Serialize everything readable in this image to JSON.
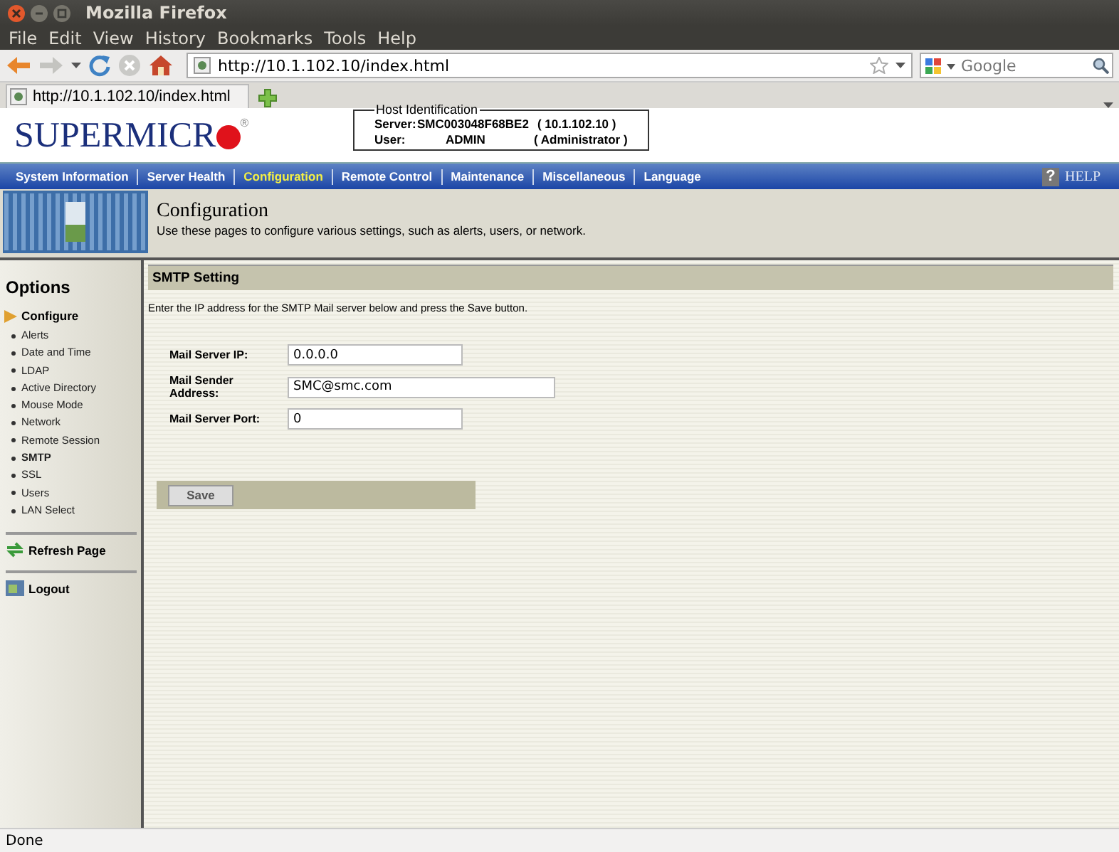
{
  "window": {
    "title": "Mozilla Firefox"
  },
  "menubar": [
    "File",
    "Edit",
    "View",
    "History",
    "Bookmarks",
    "Tools",
    "Help"
  ],
  "address_bar": {
    "value": "http://10.1.102.10/index.html"
  },
  "search": {
    "placeholder": "Google"
  },
  "tabs": [
    {
      "label": "http://10.1.102.10/index.html",
      "selected": true
    }
  ],
  "header": {
    "logo": "SUPERMICR",
    "logo_mark": "®",
    "host": {
      "legend": "Host Identification",
      "server_label": "Server:",
      "server_value": "SMC003048F68BE2",
      "server_ip": "(  10.1.102.10   )",
      "user_label": "User:",
      "user_value": "ADMIN",
      "user_role": "( Administrator )"
    }
  },
  "nav": {
    "items": [
      {
        "label": "System Information",
        "selected": false
      },
      {
        "label": "Server Health",
        "selected": false
      },
      {
        "label": "Configuration",
        "selected": true
      },
      {
        "label": "Remote Control",
        "selected": false
      },
      {
        "label": "Maintenance",
        "selected": false
      },
      {
        "label": "Miscellaneous",
        "selected": false
      },
      {
        "label": "Language",
        "selected": false
      }
    ],
    "help_icon": "?",
    "help": "HELP"
  },
  "banner": {
    "title": "Configuration",
    "description": "Use these pages to configure various settings, such as alerts, users, or network."
  },
  "sidebar": {
    "heading": "Options",
    "section": {
      "label": "Configure",
      "expanded": true,
      "children": [
        {
          "label": "Alerts",
          "selected": false
        },
        {
          "label": "Date and Time",
          "selected": false
        },
        {
          "label": "LDAP",
          "selected": false
        },
        {
          "label": "Active Directory",
          "selected": false
        },
        {
          "label": "Mouse Mode",
          "selected": false
        },
        {
          "label": "Network",
          "selected": false
        },
        {
          "label": "Remote Session",
          "selected": false
        },
        {
          "label": "SMTP",
          "selected": true
        },
        {
          "label": "SSL",
          "selected": false
        },
        {
          "label": "Users",
          "selected": false
        },
        {
          "label": "LAN Select",
          "selected": false
        }
      ]
    },
    "actions": [
      {
        "kind": "refresh",
        "label": "Refresh Page"
      },
      {
        "kind": "logout",
        "label": "Logout"
      }
    ]
  },
  "content": {
    "title": "SMTP Setting",
    "instruction": "Enter the IP address for the SMTP Mail server below and press the Save button.",
    "fields": [
      {
        "label": "Mail Server IP:",
        "value": "0.0.0.0"
      },
      {
        "label": "Mail Sender Address:",
        "value": "SMC@smc.com"
      },
      {
        "label": "Mail Server Port:",
        "value": "0"
      }
    ],
    "save_button": "Save"
  },
  "status_bar": "Done"
}
